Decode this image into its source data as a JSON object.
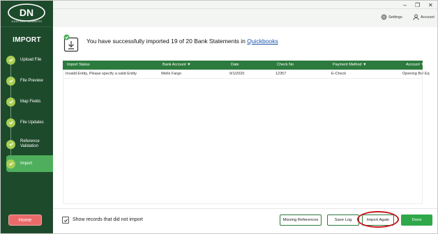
{
  "brand": {
    "logo_letters": "DN",
    "logo_text": "DANCING NUMBERS"
  },
  "sidebar": {
    "title": "IMPORT",
    "steps": [
      {
        "label": "Upload File",
        "state": "done"
      },
      {
        "label": "File Preview",
        "state": "done"
      },
      {
        "label": "Map Fields",
        "state": "done"
      },
      {
        "label": "File Updates",
        "state": "done"
      },
      {
        "label": "Reference Validation",
        "state": "done"
      },
      {
        "label": "Import",
        "state": "active"
      }
    ],
    "home_label": "Home"
  },
  "window": {
    "minimize": "–",
    "restore": "❐",
    "close": "✕"
  },
  "header": {
    "settings_label": "Settings",
    "account_label": "Account"
  },
  "message": {
    "text": "You have successfully imported 19 of 20 Bank Statements in",
    "link": "Quickbooks"
  },
  "table": {
    "columns": [
      "Import Status",
      "Bank Account ▼",
      "Date",
      "Check No",
      "Payment Method ▼",
      "Account ▼"
    ],
    "rows": [
      [
        "Invalid Entity, Please specify a valid Entity",
        "Wells Fargo",
        "9/1/2020",
        "12357",
        "E-Check",
        "Opening Bal Eq"
      ]
    ]
  },
  "footer": {
    "show_failed_label": "Show records that did not import",
    "show_failed_checked": true,
    "missing_refs_label": "Missing References",
    "save_log_label": "Save Log",
    "import_again_label": "Import Again",
    "done_label": "Done"
  },
  "colors": {
    "sidebar_bg": "#1e4a2c",
    "accent_green": "#2d7a3e",
    "step_done": "#a9cf54",
    "home_red": "#e86a6a",
    "link_blue": "#1a55a8",
    "highlight_red": "#c4161c"
  }
}
